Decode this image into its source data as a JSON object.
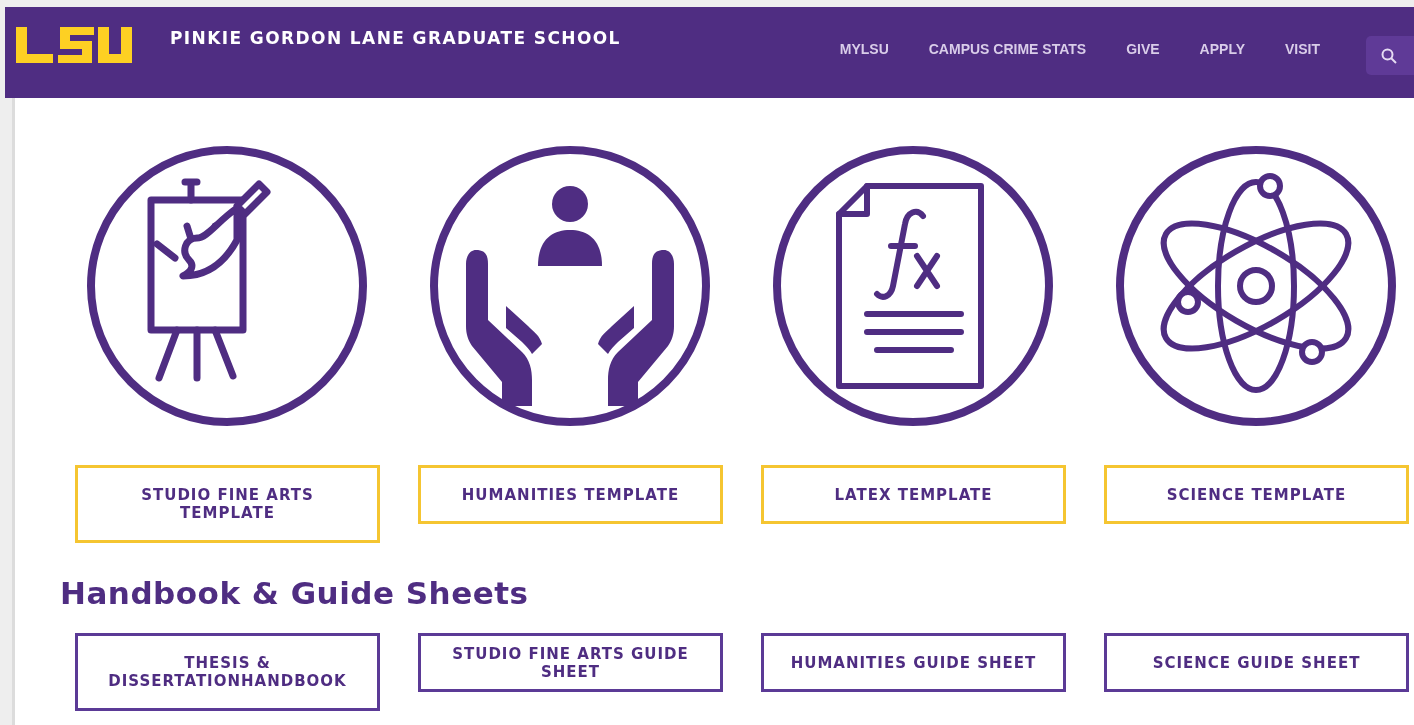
{
  "header": {
    "title": "PINKIE GORDON LANE GRADUATE SCHOOL",
    "nav": [
      {
        "label": "MYLSU"
      },
      {
        "label": "CAMPUS CRIME STATS"
      },
      {
        "label": "GIVE"
      },
      {
        "label": "APPLY"
      },
      {
        "label": "VISIT"
      }
    ]
  },
  "templates": {
    "kind": "gold",
    "items": [
      {
        "label": "STUDIO FINE ARTS TEMPLATE"
      },
      {
        "label": "HUMANITIES TEMPLATE"
      },
      {
        "label": "LATEX TEMPLATE"
      },
      {
        "label": "SCIENCE TEMPLATE"
      }
    ]
  },
  "guides": {
    "heading": "Handbook & Guide Sheets",
    "kind": "purple",
    "items": [
      {
        "label": "THESIS & DISSERTATIONHANDBOOK"
      },
      {
        "label": "STUDIO FINE ARTS GUIDE SHEET"
      },
      {
        "label": "HUMANITIES GUIDE SHEET"
      },
      {
        "label": "SCIENCE GUIDE SHEET"
      }
    ]
  }
}
